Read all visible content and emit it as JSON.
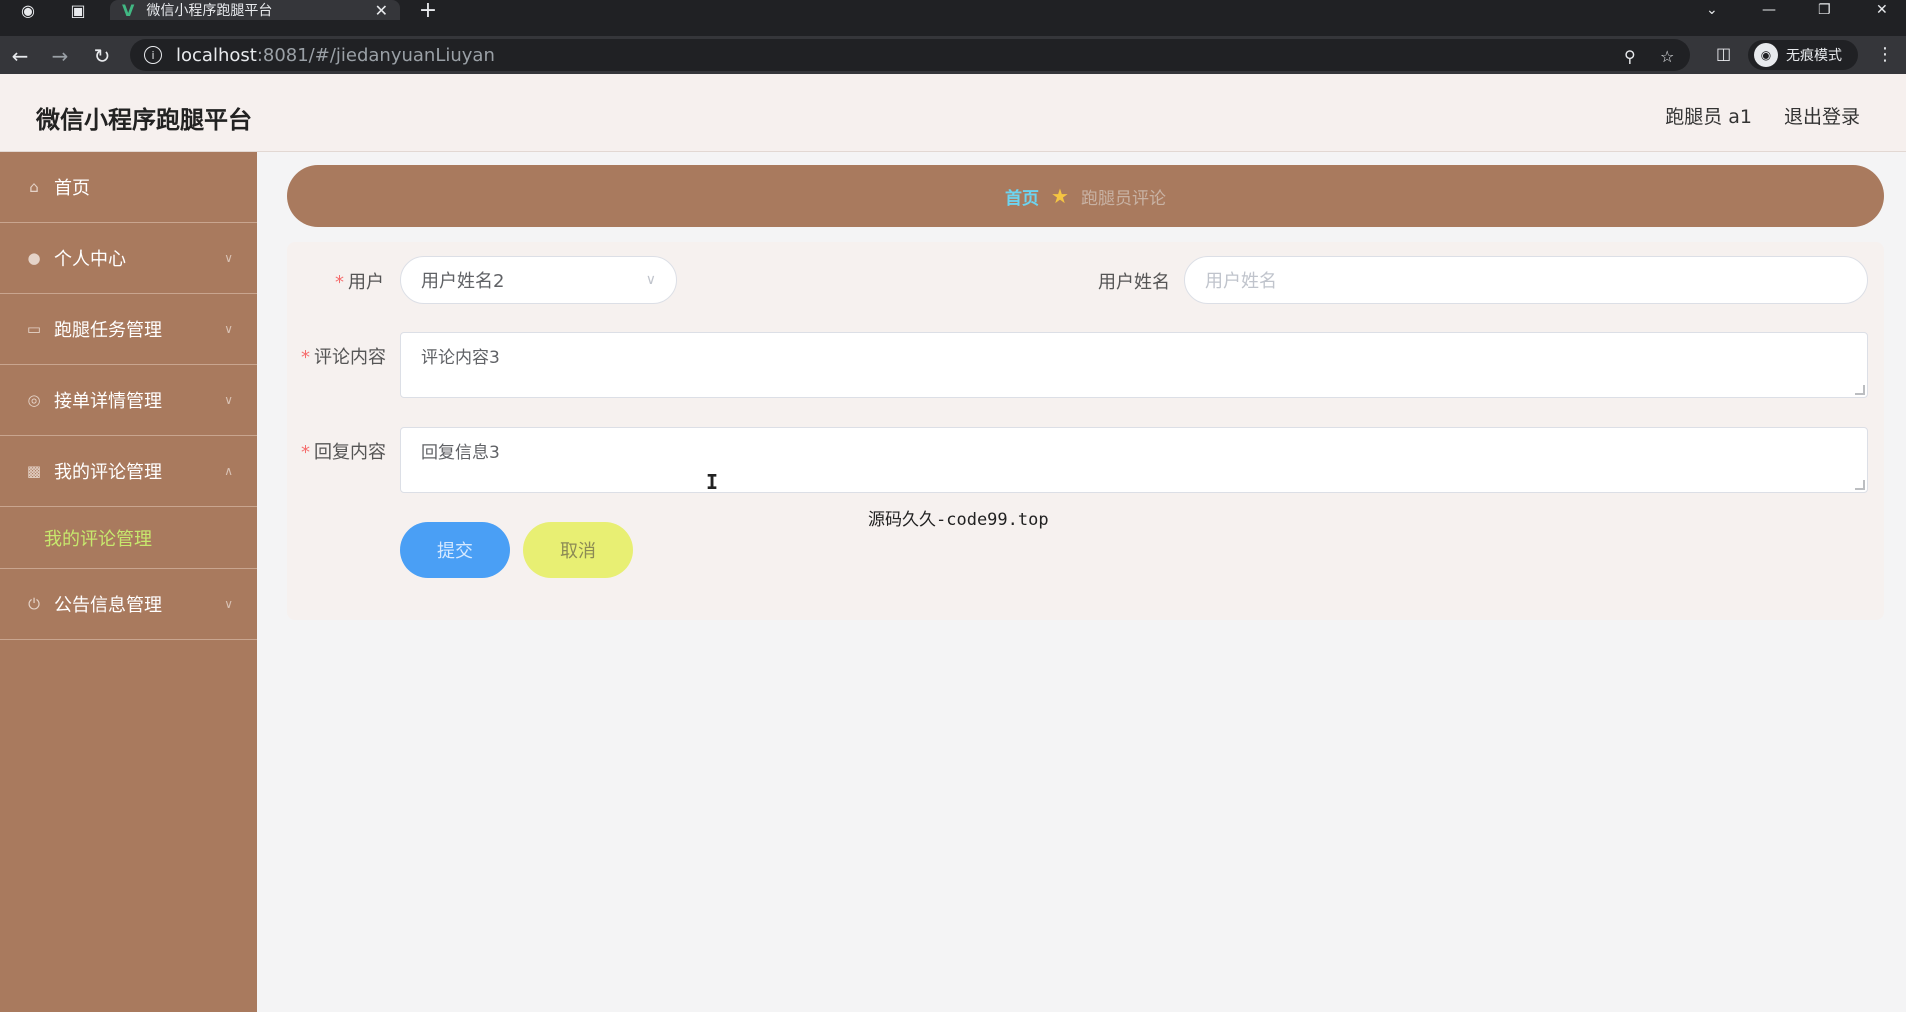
{
  "browser": {
    "tab_title": "微信小程序跑腿平台",
    "url_host": "localhost",
    "url_rest": ":8081/#/jiedanyuanLiuyan",
    "incognito_label": "无痕模式"
  },
  "header": {
    "title": "微信小程序跑腿平台",
    "user_label": "跑腿员 a1",
    "logout_label": "退出登录"
  },
  "sidebar": {
    "items": [
      {
        "label": "首页",
        "icon": "home-icon"
      },
      {
        "label": "个人中心",
        "icon": "user-icon"
      },
      {
        "label": "跑腿任务管理",
        "icon": "task-icon"
      },
      {
        "label": "接单详情管理",
        "icon": "mic-icon"
      },
      {
        "label": "我的评论管理",
        "icon": "comment-icon"
      },
      {
        "label": "公告信息管理",
        "icon": "power-icon"
      }
    ],
    "submenu_active": "我的评论管理"
  },
  "breadcrumb": {
    "home": "首页",
    "current": "跑腿员评论"
  },
  "form": {
    "user_label": "用户",
    "user_value": "用户姓名2",
    "username_label": "用户姓名",
    "username_placeholder": "用户姓名",
    "comment_label": "评论内容",
    "comment_value": "评论内容3",
    "reply_label": "回复内容",
    "reply_value": "回复信息3",
    "submit_label": "提交",
    "cancel_label": "取消"
  },
  "overlay_note": "源码久久-code99.top",
  "colors": {
    "sidebar_bg": "#a97a5e",
    "submit_btn": "#4a9ff5",
    "cancel_btn": "#e8ef73",
    "active_submenu": "#c7e86d"
  }
}
